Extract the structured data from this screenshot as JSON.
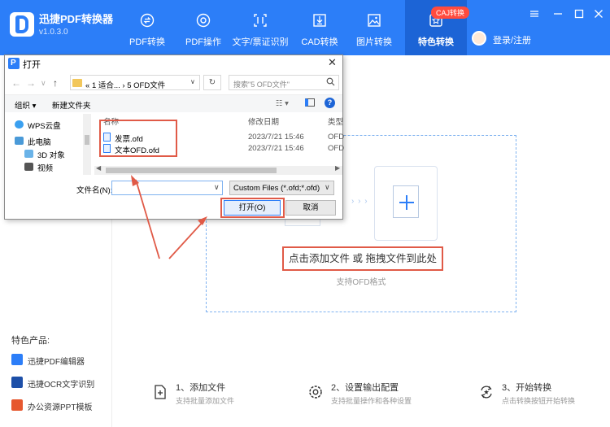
{
  "app": {
    "name": "迅捷PDF转换器",
    "version": "v1.0.3.0"
  },
  "nav": {
    "items": [
      {
        "label": "PDF转换",
        "icon": "sync-icon"
      },
      {
        "label": "PDF操作",
        "icon": "gear-icon"
      },
      {
        "label": "文字/票证识别",
        "icon": "scan-icon"
      },
      {
        "label": "CAD转换",
        "icon": "download-icon"
      },
      {
        "label": "图片转换",
        "icon": "image-icon"
      },
      {
        "label": "特色转换",
        "icon": "star-box-icon"
      }
    ],
    "active": "特色转换",
    "badge": "CAJ转换",
    "login": "登录/注册"
  },
  "sidebar": {
    "feature_title": "特色产品:",
    "features": [
      {
        "label": "迅捷PDF编辑器"
      },
      {
        "label": "迅捷OCR文字识别"
      },
      {
        "label": "办公资源PPT模板"
      }
    ]
  },
  "main": {
    "drop_text": "点击添加文件 或 拖拽文件到此处",
    "drop_hint": "支持OFD格式",
    "steps": [
      {
        "title": "1、添加文件",
        "desc": "支持批量添加文件"
      },
      {
        "title": "2、设置输出配置",
        "desc": "支持批量操作和各种设置"
      },
      {
        "title": "3、开始转换",
        "desc": "点击转换按钮开始转换"
      }
    ]
  },
  "dialog": {
    "title": "打开",
    "path_parts": [
      "«",
      "1 适合...",
      "›",
      "5 OFD文件"
    ],
    "search_placeholder": "搜索\"5 OFD文件\"",
    "organize": "组织 ▾",
    "new_folder": "新建文件夹",
    "tree": [
      {
        "label": "WPS云盘"
      },
      {
        "label": "此电脑"
      },
      {
        "label": "3D 对象"
      },
      {
        "label": "视频"
      }
    ],
    "columns": {
      "name": "名称",
      "modified": "修改日期",
      "type": "类型"
    },
    "files": [
      {
        "name": "发票.ofd",
        "modified": "2023/7/21 15:46",
        "type": "OFD"
      },
      {
        "name": "文本OFD.ofd",
        "modified": "2023/7/21 15:46",
        "type": "OFD"
      }
    ],
    "filename_label": "文件名(N):",
    "filename_value": "",
    "filetype": "Custom Files (*.ofd;*.ofd)",
    "open_button": "打开(O)",
    "cancel_button": "取消"
  },
  "colors": {
    "brand_blue": "#2c7ef8",
    "annotation_red": "#e05a47",
    "badge_red": "#ff4b3e"
  }
}
